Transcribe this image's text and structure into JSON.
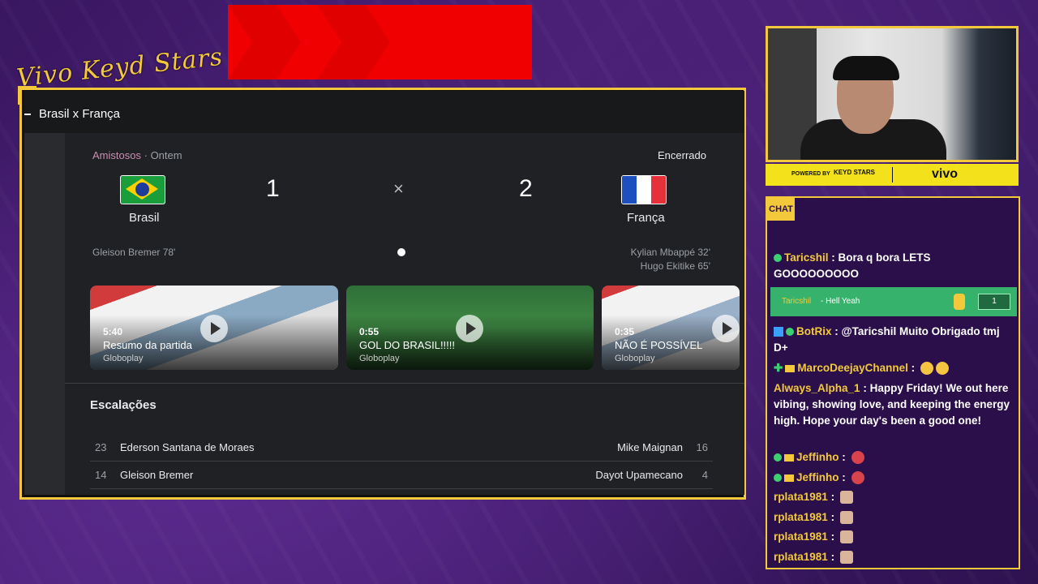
{
  "overlay": {
    "brand": "Vivo Keyd Stars",
    "cam_powered_by": "POWERED BY",
    "cam_partner": "KEYD STARS",
    "cam_sponsor": "vivo",
    "chat_label": "CHAT"
  },
  "window": {
    "title": "Brasil x França"
  },
  "match": {
    "competition": "Amistosos",
    "separator": "·",
    "when": "Ontem",
    "status": "Encerrado",
    "home": {
      "name": "Brasil",
      "score": "1",
      "scorers": [
        "Gleison Bremer 78'"
      ]
    },
    "away": {
      "name": "França",
      "score": "2",
      "scorers": [
        "Kylian Mbappé 32'",
        "Hugo Ekitike 65'"
      ]
    },
    "vs": "×"
  },
  "videos": [
    {
      "duration": "5:40",
      "title": "Resumo da partida",
      "source": "Globoplay"
    },
    {
      "duration": "0:55",
      "title": "GOL DO BRASIL!!!!!",
      "source": "Globoplay"
    },
    {
      "duration": "0:35",
      "title": "NÃO É POSSÍVEL",
      "source": "Globoplay"
    }
  ],
  "lineups": {
    "title": "Escalações",
    "rows": [
      {
        "home_num": "23",
        "home_name": "Ederson Santana de Moraes",
        "away_name": "Mike Maignan",
        "away_num": "16"
      },
      {
        "home_num": "14",
        "home_name": "Gleison Bremer",
        "away_name": "Dayot Upamecano",
        "away_num": "4"
      }
    ]
  },
  "chat": {
    "messages": [
      {
        "user": "Taricshil",
        "text": ": Bora q bora LETS GOOOOOOOOO"
      },
      {
        "user": "BotRix",
        "text": ": @Taricshil Muito Obrigado tmj D+"
      },
      {
        "user": "MarcoDeejayChannel",
        "text": ":"
      },
      {
        "user": "Always_Alpha_1",
        "text": ": Happy Friday! We out here vibing, showing love, and keeping the energy high. Hope your day's been a good one!"
      },
      {
        "user": "Jeffinho",
        "text": ":"
      },
      {
        "user": "Jeffinho",
        "text": ":"
      },
      {
        "user": "rplata1981",
        "text": ":"
      },
      {
        "user": "rplata1981",
        "text": ":"
      },
      {
        "user": "rplata1981",
        "text": ":"
      },
      {
        "user": "rplata1981",
        "text": ":"
      }
    ],
    "hype": {
      "user": "Taricshil",
      "text": "- Hell Yeah",
      "count": "1"
    }
  },
  "colors": {
    "accent_gold": "#f3c93b",
    "banner_red": "#f00000",
    "panel_bg": "#202124",
    "chat_bg": "#2b0f4a"
  }
}
